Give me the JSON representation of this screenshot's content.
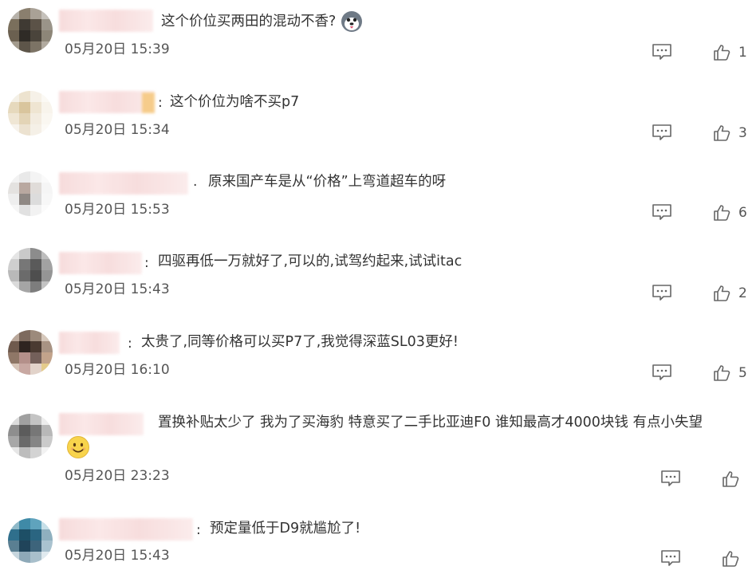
{
  "comments": [
    {
      "text": "这个价位买两田的混动不香?",
      "date": "05月20日 15:39",
      "likes": "1"
    },
    {
      "text": "这个价位为啥不买p7",
      "date": "05月20日 15:34",
      "likes": "3"
    },
    {
      "text": "原来国产车是从“价格”上弯道超车的呀",
      "date": "05月20日 15:53",
      "likes": "6"
    },
    {
      "text": "四驱再低一万就好了,可以的,试驾约起来,试试itac",
      "date": "05月20日 15:43",
      "likes": "2"
    },
    {
      "text": "太贵了,同等价格可以买P7了,我觉得深蓝SL03更好!",
      "date": "05月20日 16:10",
      "likes": "5"
    },
    {
      "text": "置换补贴太少了 我为了买海豹 特意买了二手比亚迪F0 谁知最高才4000块钱 有点小失望",
      "date": "05月20日 23:23",
      "likes": ""
    },
    {
      "text": "预定量低于D9就尴尬了!",
      "date": "05月20日 15:43",
      "likes": ""
    }
  ],
  "separators": {
    "colon": ":",
    "period": "."
  },
  "icons": {
    "reply": "comment-bubble-icon",
    "like": "thumbs-up-icon",
    "sticker": "husky-emoji-icon",
    "smile": "smile-emoji-icon"
  },
  "colors": {
    "text": "#333333",
    "meta": "#555555",
    "icon": "#666666"
  }
}
